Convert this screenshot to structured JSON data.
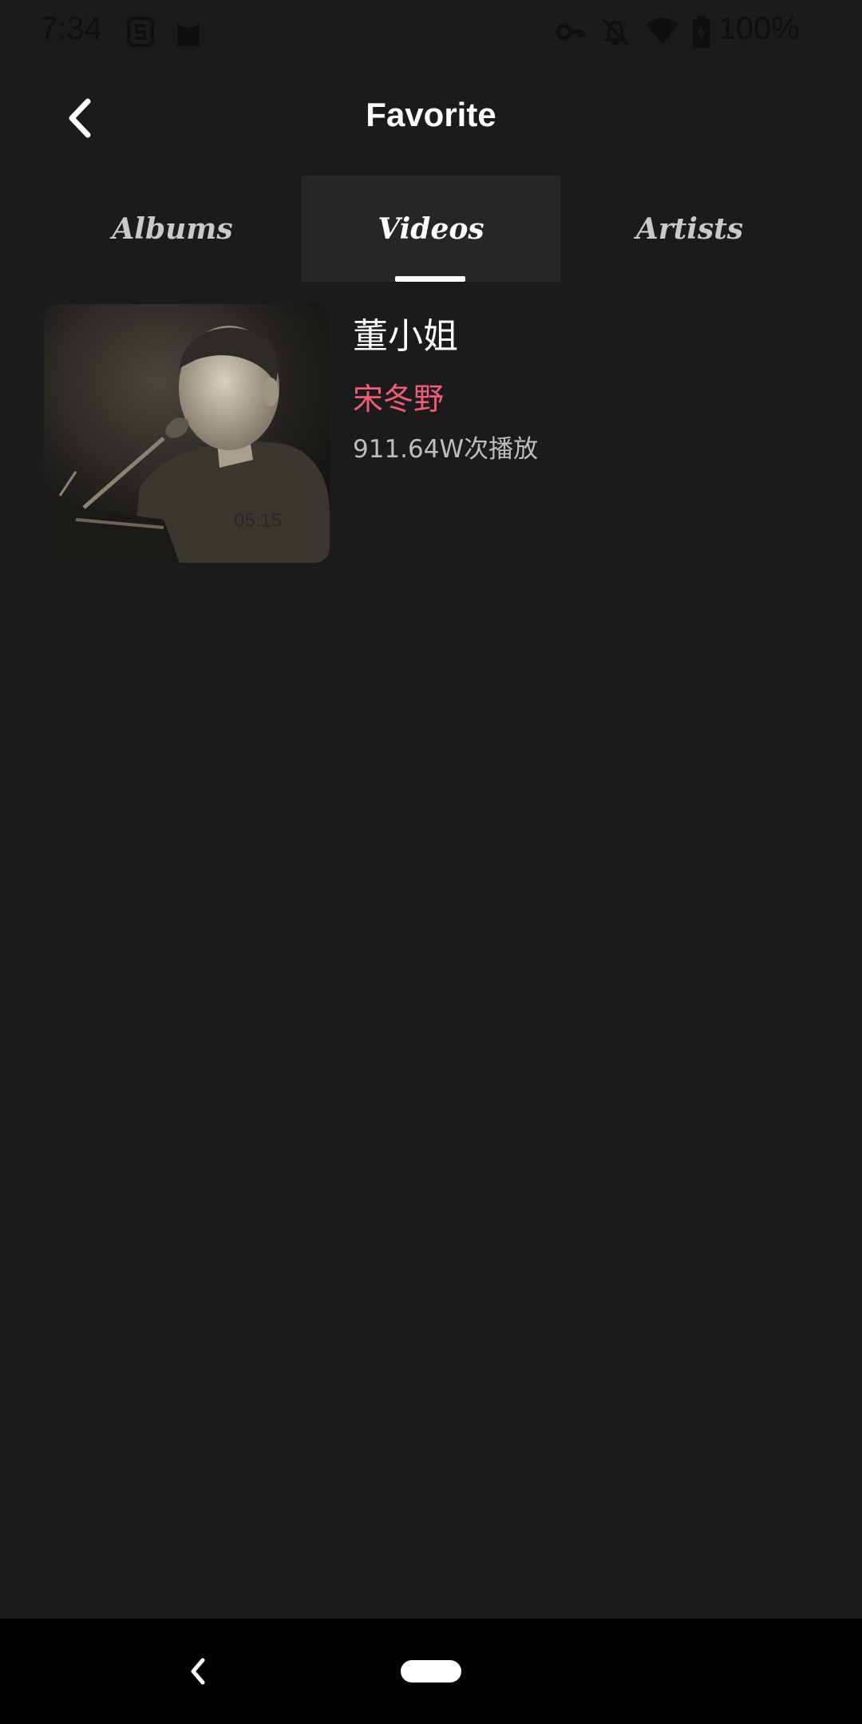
{
  "status_bar": {
    "time": "7:34",
    "battery": "100%",
    "icons": [
      "s-badge-icon",
      "cat-icon",
      "key-icon",
      "bell-off-icon",
      "wifi-icon",
      "battery-charging-icon"
    ]
  },
  "header": {
    "title": "Favorite",
    "back_icon": "chevron-left-icon"
  },
  "tabs": [
    {
      "label": "Albums",
      "active": false
    },
    {
      "label": "Videos",
      "active": true
    },
    {
      "label": "Artists",
      "active": false
    }
  ],
  "videos": [
    {
      "title": "董小姐",
      "artist": "宋冬野",
      "plays": "911.64W次播放",
      "duration": "05:15"
    }
  ],
  "colors": {
    "background": "#1b1b1b",
    "active_tab_bg": "#262626",
    "artist_accent": "#ee5d77",
    "nav_bar": "#000000"
  }
}
